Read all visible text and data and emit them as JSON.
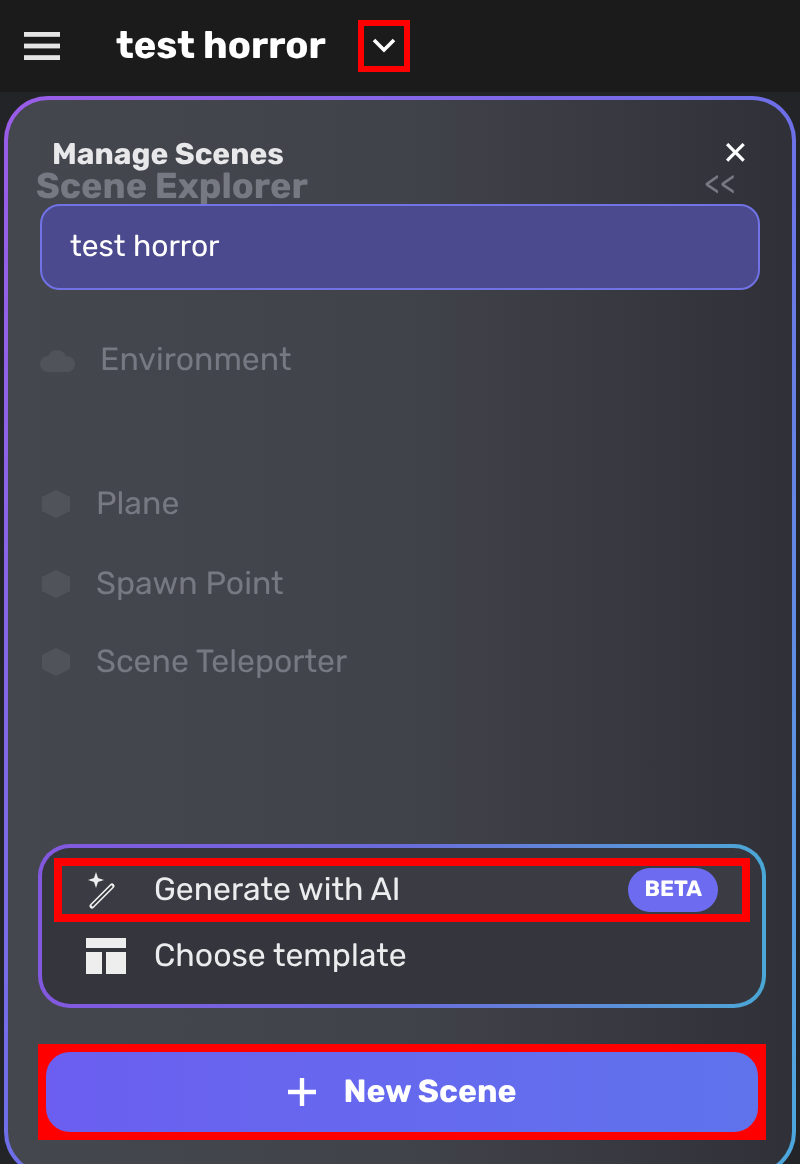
{
  "top_bar": {
    "title": "test horror",
    "dropdown_highlighted": true
  },
  "background": {
    "title": "Scene Explorer",
    "collapse": "<<",
    "items": [
      {
        "kind": "group",
        "label": "Environment"
      },
      {
        "kind": "object",
        "label": "Plane"
      },
      {
        "kind": "object",
        "label": "Spawn Point"
      },
      {
        "kind": "object",
        "label": "Scene Teleporter"
      }
    ]
  },
  "dialog": {
    "title": "Manage Scenes",
    "close": "✕",
    "scenes": [
      {
        "name": "test horror",
        "selected": true
      }
    ],
    "actions": [
      {
        "kind": "ai",
        "label": "Generate with AI",
        "badge": "BETA",
        "highlighted": true
      },
      {
        "kind": "template",
        "label": "Choose template",
        "highlighted": false
      }
    ],
    "primary_button": {
      "label": "New Scene",
      "highlighted": true
    }
  }
}
